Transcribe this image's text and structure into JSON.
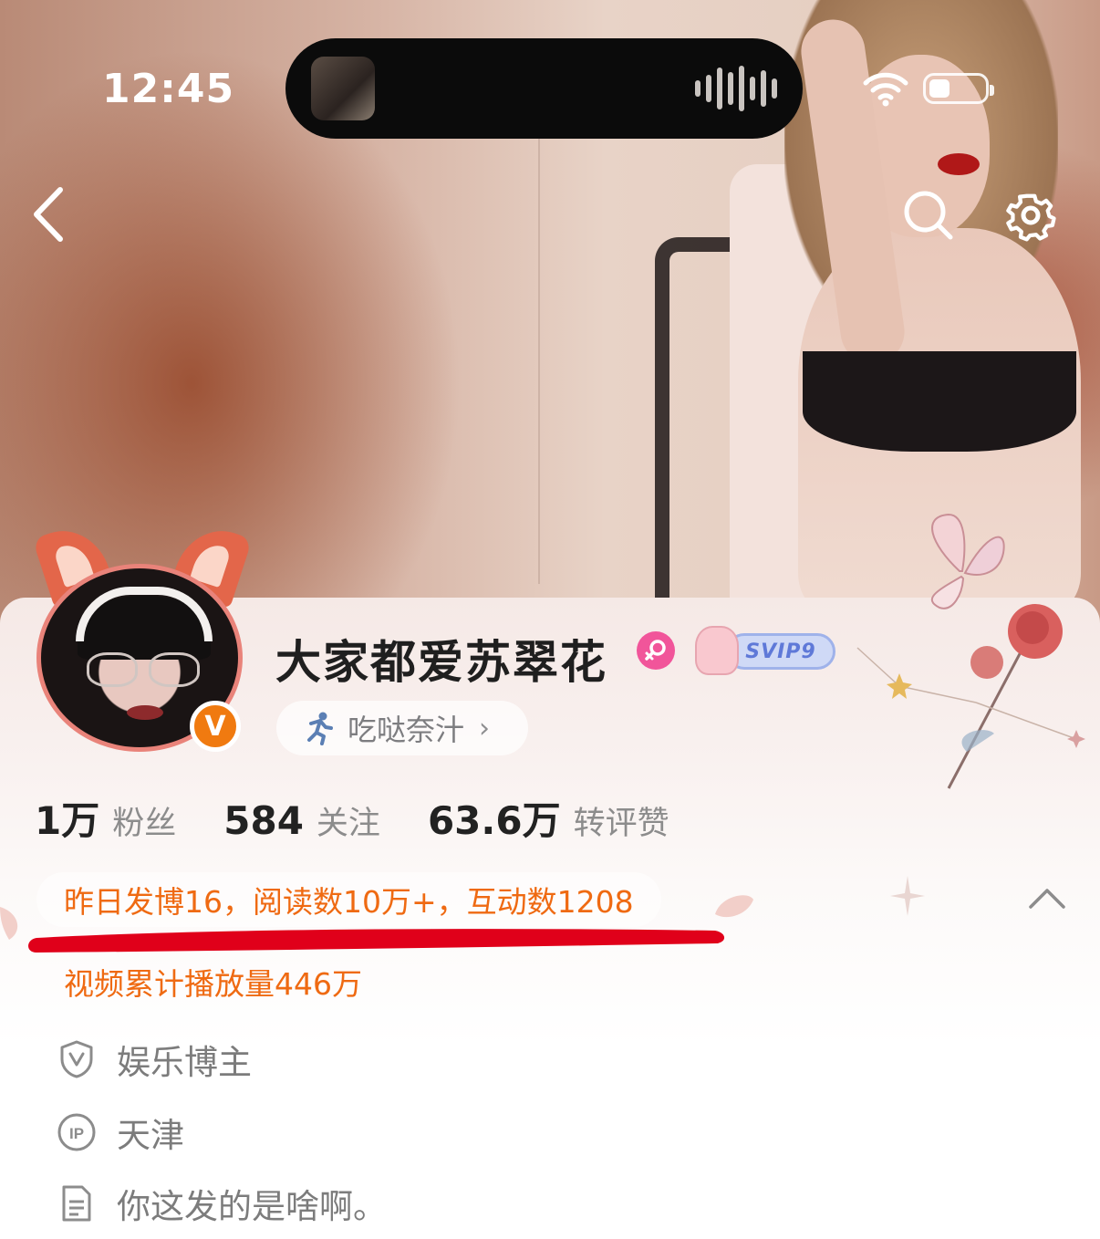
{
  "status_bar": {
    "time": "12:45"
  },
  "profile": {
    "name": "大家都爱苏翠花",
    "svip_label": "SVIP9",
    "status_chip": {
      "label": "吃哒奈汁",
      "chevron": "›"
    },
    "verified_badge": "V",
    "stats": [
      {
        "value": "1万",
        "label": "粉丝"
      },
      {
        "value": "584",
        "label": "关注"
      },
      {
        "value": "63.6万",
        "label": "转评赞"
      }
    ],
    "yesterday_summary": "昨日发博16，阅读数10万+，互动数1208",
    "video_summary": "视频累计播放量446万",
    "info": [
      {
        "icon": "shield-v-icon",
        "text": "娱乐博主"
      },
      {
        "icon": "ip-icon",
        "text": "天津"
      },
      {
        "icon": "document-icon",
        "text": "你这发的是啥啊。"
      }
    ]
  },
  "colors": {
    "accent_orange": "#ef6a12",
    "verified_orange": "#f07a10",
    "gender_pink": "#f1559a",
    "annotation_red": "#e0001a",
    "svip_blue": "#5f79d8"
  },
  "icons": {
    "back": "chevron-left-icon",
    "search": "search-icon",
    "settings": "gear-icon",
    "collapse": "chevron-up-icon",
    "gender": "female-icon",
    "status": "running-person-icon"
  }
}
